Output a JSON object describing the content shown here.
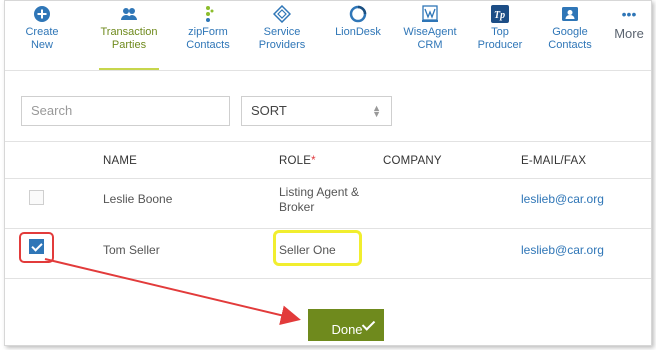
{
  "toolbar": {
    "items": [
      {
        "label1": "Create New",
        "label2": "",
        "icon": "plus-circle-icon"
      },
      {
        "label1": "Transaction",
        "label2": "Parties",
        "icon": "people-icon"
      },
      {
        "label1": "zipForm",
        "label2": "Contacts",
        "icon": "zipform-icon"
      },
      {
        "label1": "Service",
        "label2": "Providers",
        "icon": "diamond-icon"
      },
      {
        "label1": "LionDesk",
        "label2": "",
        "icon": "liondesk-icon"
      },
      {
        "label1": "WiseAgent",
        "label2": "CRM",
        "icon": "wiseagent-icon"
      },
      {
        "label1": "Top",
        "label2": "Producer",
        "icon": "tp-icon"
      },
      {
        "label1": "Google",
        "label2": "Contacts",
        "icon": "contact-card-icon"
      },
      {
        "label1": "More",
        "label2": "",
        "icon": "ellipsis-icon"
      }
    ],
    "active": "Transaction Parties"
  },
  "search": {
    "placeholder": "Search"
  },
  "sort": {
    "value": "SORT"
  },
  "table": {
    "headers": {
      "name": "NAME",
      "role": "ROLE",
      "role_required": "*",
      "company": "COMPANY",
      "email": "E-MAIL/FAX"
    },
    "rows": [
      {
        "name": "Leslie Boone",
        "role_line1": "Listing Agent &",
        "role_line2": "Broker",
        "company": "",
        "email": "leslieb@car.org",
        "checked": false
      },
      {
        "name": "Tom Seller",
        "role_line1": "Seller One",
        "role_line2": "",
        "company": "",
        "email": "leslieb@car.org",
        "checked": true
      }
    ]
  },
  "footer": {
    "done_label": "Done"
  },
  "colors": {
    "accent_green": "#6f8a1d",
    "link_blue": "#2f76b7",
    "highlight_red": "#e23b3b",
    "highlight_yellow": "#f1ee2f"
  }
}
